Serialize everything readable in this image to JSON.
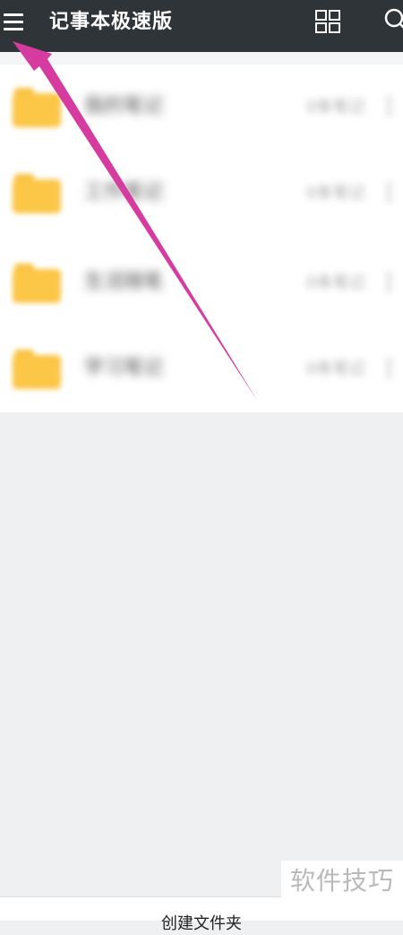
{
  "app": {
    "title": "记事本极速版"
  },
  "header": {
    "menu_icon": "menu-icon",
    "grid_icon": "grid-view-icon",
    "search_icon": "search-icon"
  },
  "folders": [
    {
      "name": "我的笔记",
      "count": "0条笔记"
    },
    {
      "name": "工作笔记",
      "count": "0条笔记"
    },
    {
      "name": "生活随笔",
      "count": "0条笔记"
    },
    {
      "name": "学习笔记",
      "count": "0条笔记"
    }
  ],
  "footer": {
    "create_folder_label": "创建文件夹"
  },
  "watermark": {
    "text": "软件技巧"
  },
  "colors": {
    "header_bg": "#2f3438",
    "folder_yellow": "#fcc646",
    "arrow_magenta": "#d63ba0",
    "page_bg": "#eff0f2"
  }
}
